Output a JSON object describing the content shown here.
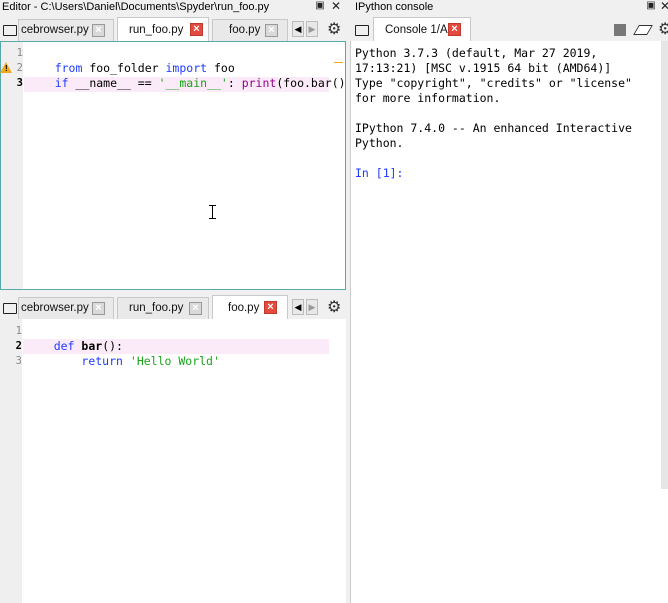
{
  "editor": {
    "window_title": "Editor - C:\\Users\\Daniel\\Documents\\Spyder\\run_foo.py",
    "top_tabs": [
      {
        "label": "cebrowser.py",
        "active": false
      },
      {
        "label": "run_foo.py",
        "active": true
      },
      {
        "label": "foo.py",
        "active": false
      }
    ],
    "bottom_tabs": [
      {
        "label": "cebrowser.py",
        "active": false
      },
      {
        "label": "run_foo.py",
        "active": false
      },
      {
        "label": "foo.py",
        "active": true
      }
    ],
    "top_code": {
      "line_numbers": [
        "1",
        "2",
        "3"
      ],
      "line1": {
        "kw1": "from",
        "mod": " foo_folder ",
        "kw2": "import",
        "name": " foo"
      },
      "line2": {
        "kw": "if",
        "a": " __name__ == ",
        "str": "'__main__'",
        "b": ": ",
        "bi": "print",
        "c": "(foo.bar())"
      },
      "warning_icon": "warning-triangle-icon"
    },
    "bottom_code": {
      "line_numbers": [
        "1",
        "2",
        "3"
      ],
      "line1": {
        "kw": "def",
        "fn": " bar",
        "rest": "():"
      },
      "line2": {
        "indent": "    ",
        "kw": "return",
        "sp": " ",
        "str": "'Hello World'"
      }
    }
  },
  "console": {
    "window_title": "IPython console",
    "tab_label": "Console 1/A",
    "output_lines": [
      "Python 3.7.3 (default, Mar 27 2019,",
      "17:13:21) [MSC v.1915 64 bit (AMD64)]",
      "Type \"copyright\", \"credits\" or \"license\"",
      "for more information.",
      "",
      "IPython 7.4.0 -- An enhanced Interactive",
      "Python."
    ],
    "prompt": "In [1]:"
  },
  "icons": {
    "close": "close-icon",
    "undock": "undock-icon",
    "gear": "gear-icon",
    "stop": "stop-icon",
    "eraser": "eraser-icon",
    "browse_tabs": "browse-tabs-icon"
  },
  "colors": {
    "keyword": "#1f3aff",
    "string": "#1aa31a",
    "builtin": "#900090",
    "current_line": "#fbeaf7",
    "close_active": "#e34b40"
  }
}
